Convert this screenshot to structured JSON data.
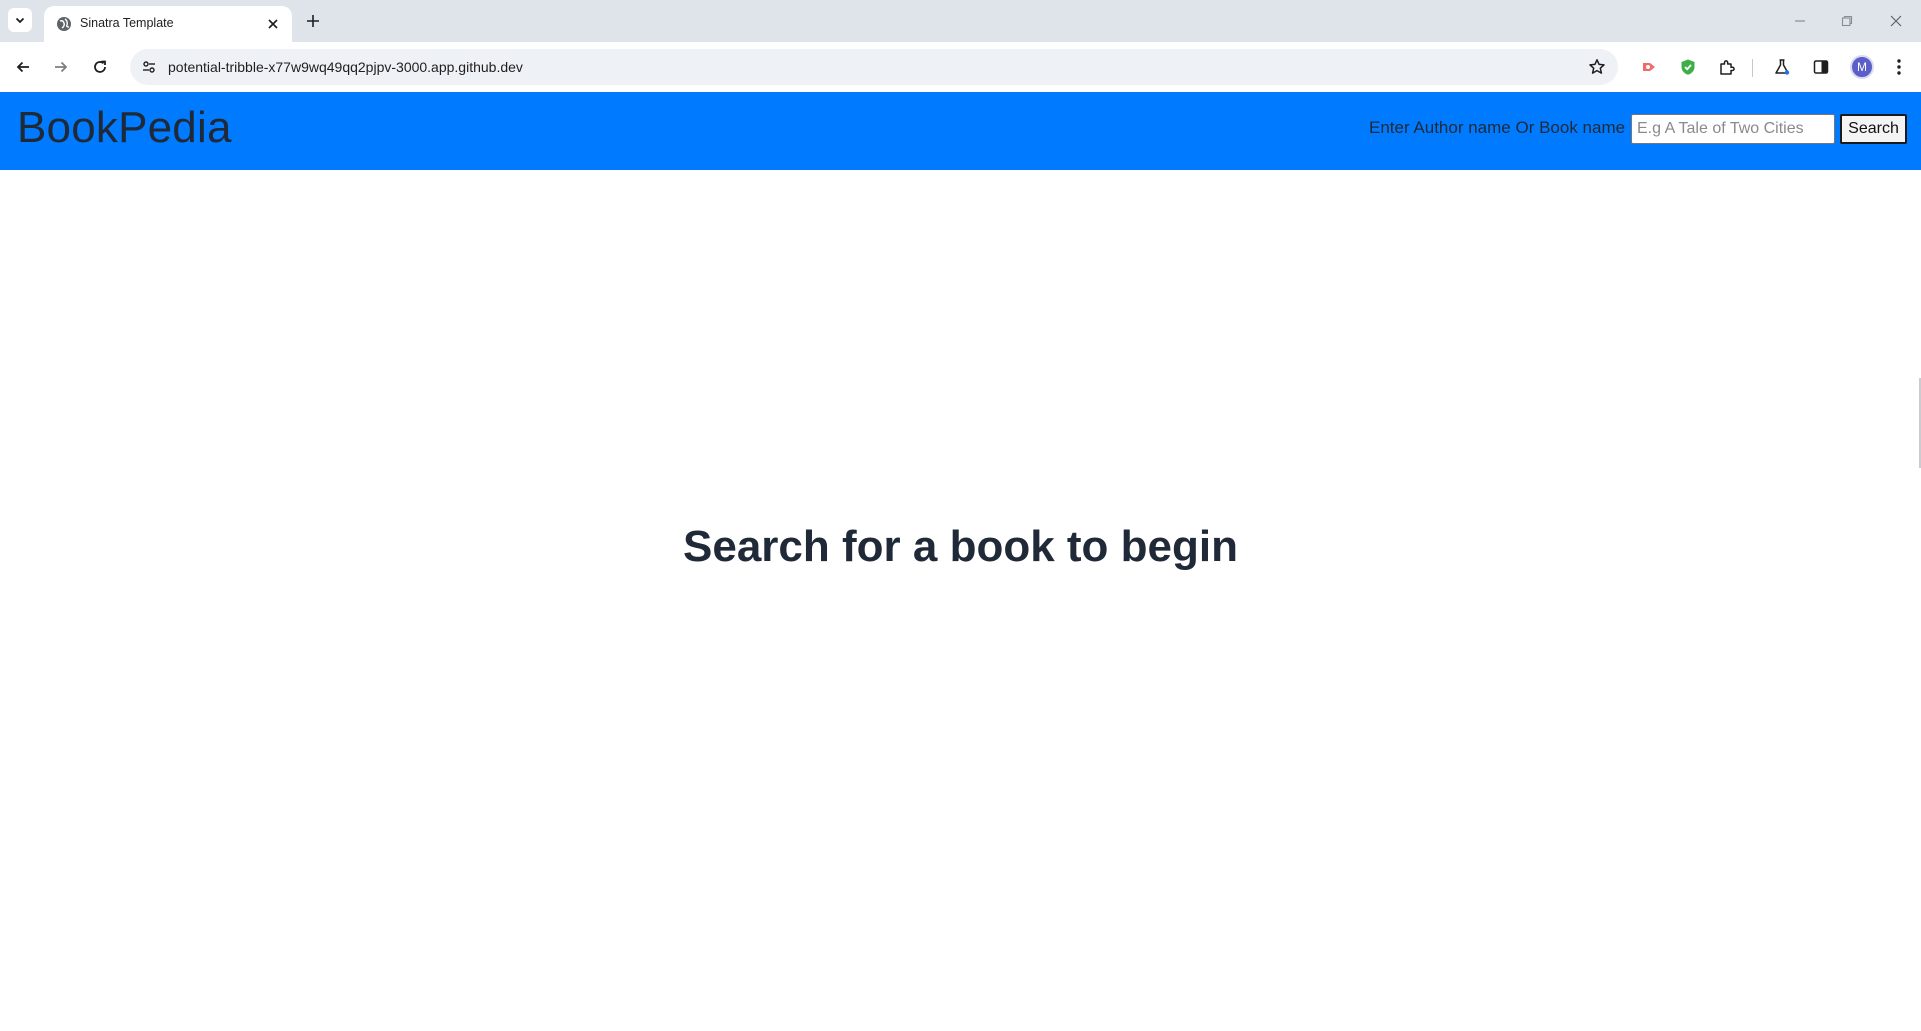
{
  "browser": {
    "tab": {
      "title": "Sinatra Template"
    },
    "address_bar": {
      "url": "potential-tribble-x77w9wq49qq2pjpv-3000.app.github.dev"
    },
    "profile": {
      "initial": "M"
    }
  },
  "app": {
    "brand": "BookPedia",
    "search": {
      "label": "Enter Author name Or Book name",
      "placeholder": "E.g A Tale of Two Cities",
      "value": "",
      "button_label": "Search"
    },
    "main": {
      "heading": "Search for a book to begin"
    }
  },
  "colors": {
    "navbar_background": "#007bff",
    "tabstrip_background": "#dfe3ea",
    "text_dark": "#1f2937",
    "profile_avatar": "#5b5fc7"
  },
  "icons": {
    "tab_search": "chevron-down-icon",
    "favicon": "globe-icon",
    "tab_close": "close-icon",
    "new_tab": "plus-icon",
    "back": "arrow-left-icon",
    "forward": "arrow-right-icon",
    "reload": "reload-icon",
    "site_info": "tune-icon",
    "bookmark": "star-icon",
    "extensions": [
      "screencast-extension-icon",
      "shield-extension-icon",
      "puzzle-extensions-icon",
      "labs-flask-icon",
      "side-panel-icon"
    ],
    "menu": "kebab-menu-icon",
    "window": [
      "minimize-icon",
      "restore-icon",
      "window-close-icon"
    ]
  }
}
